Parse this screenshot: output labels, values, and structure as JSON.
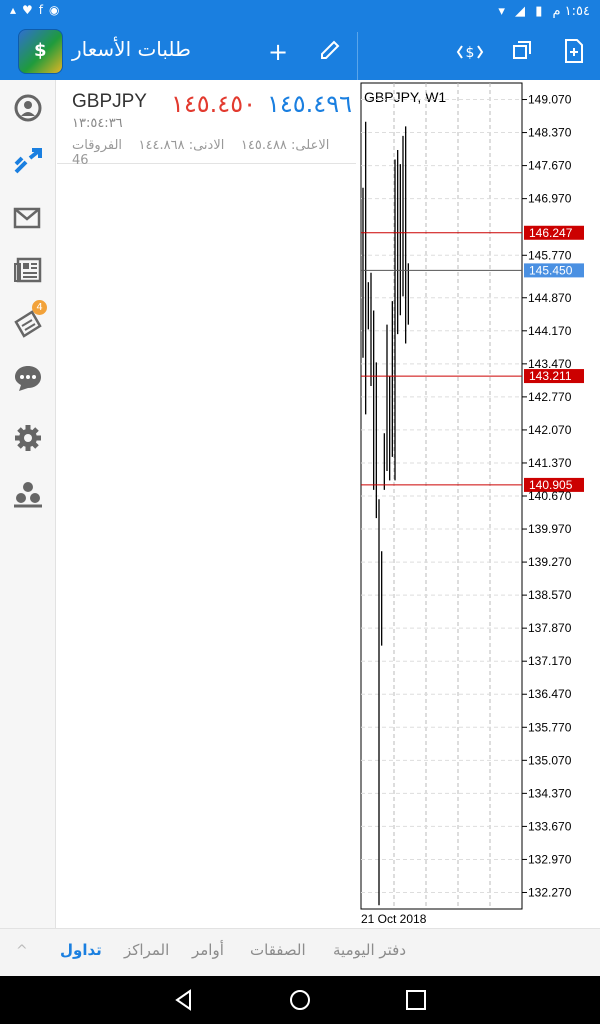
{
  "status_bar": {
    "time": "١:٥٤ م",
    "left_icons": [
      "notification-icon",
      "heart-icon",
      "facebook-icon",
      "chrome-icon"
    ],
    "right_icons": [
      "wifi-icon",
      "signal-icon",
      "battery-icon"
    ]
  },
  "app_bar": {
    "title": "طلبات الأسعار",
    "actions": [
      "add-icon",
      "edit-icon"
    ],
    "chart_actions": [
      "trade-icon",
      "windows-icon",
      "new-chart-icon"
    ]
  },
  "sidebar": {
    "items": [
      "account",
      "trade",
      "mail",
      "news",
      "calendar",
      "chat",
      "settings",
      "community"
    ],
    "mail_badge": "4"
  },
  "quote": {
    "symbol": "GBPJPY",
    "bid": "١٤٥.٤٥٠",
    "ask": "١٤٥.٤٩٦",
    "time": "١٣:٥٤:٣٦",
    "low_label": "الادنى: ١٤٤.٨٦٨",
    "high_label": "الاعلى: ١٤٥.٤٨٨",
    "spread_label": "الفروقات 46"
  },
  "chart": {
    "title": "GBPJPY, W1",
    "date_label": "21 Oct 2018",
    "line_color": "#000000",
    "level_color": "#cc0000",
    "current_color": "#4a90e2"
  },
  "chart_data": {
    "type": "bar",
    "title": "GBPJPY, W1",
    "x_label": "21 Oct 2018",
    "ylim": [
      131.92,
      149.42
    ],
    "y_ticks": [
      149.07,
      148.37,
      147.67,
      146.97,
      145.77,
      144.87,
      144.17,
      143.47,
      142.77,
      142.07,
      141.37,
      140.67,
      139.97,
      139.27,
      138.57,
      137.87,
      137.17,
      136.47,
      135.77,
      135.07,
      134.37,
      133.67,
      132.97,
      132.27
    ],
    "y_tick_labels": [
      "149.070",
      "148.370",
      "147.670",
      "146.970",
      "145.770",
      "144.870",
      "144.170",
      "143.470",
      "142.770",
      "142.070",
      "141.370",
      "140.670",
      "139.970",
      "139.270",
      "138.570",
      "137.870",
      "137.170",
      "136.470",
      "135.770",
      "135.070",
      "134.370",
      "133.670",
      "132.970",
      "132.270"
    ],
    "levels": [
      {
        "label": "146.247",
        "value": 146.247,
        "kind": "line"
      },
      {
        "label": "145.450",
        "value": 145.45,
        "kind": "current"
      },
      {
        "label": "143.211",
        "value": 143.211,
        "kind": "line"
      },
      {
        "label": "140.905",
        "value": 140.905,
        "kind": "line"
      }
    ],
    "bars": [
      {
        "h": 147.2,
        "l": 143.6
      },
      {
        "h": 148.6,
        "l": 142.4
      },
      {
        "h": 145.2,
        "l": 144.2
      },
      {
        "h": 145.4,
        "l": 143.0
      },
      {
        "h": 144.6,
        "l": 140.8
      },
      {
        "h": 143.5,
        "l": 140.2
      },
      {
        "h": 140.6,
        "l": 132.0
      },
      {
        "h": 139.5,
        "l": 137.5
      },
      {
        "h": 142.0,
        "l": 140.8
      },
      {
        "h": 144.3,
        "l": 141.2
      },
      {
        "h": 143.2,
        "l": 141.0
      },
      {
        "h": 144.8,
        "l": 141.5
      },
      {
        "h": 147.8,
        "l": 141.0
      },
      {
        "h": 148.0,
        "l": 144.1
      },
      {
        "h": 147.7,
        "l": 144.5
      },
      {
        "h": 148.3,
        "l": 144.9
      },
      {
        "h": 148.5,
        "l": 143.9
      },
      {
        "h": 145.6,
        "l": 144.3
      }
    ]
  },
  "bottom_nav": [
    "تداول",
    "المراكز",
    "أوامر",
    "الصفقات",
    "دفتر اليومية"
  ]
}
